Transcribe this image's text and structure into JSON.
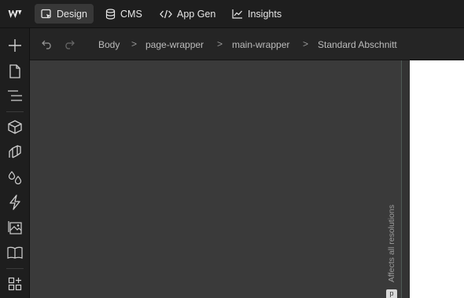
{
  "topbar": {
    "logo": "webflow-logo",
    "tabs": [
      {
        "label": "Design",
        "icon": "design-icon",
        "active": true
      },
      {
        "label": "CMS",
        "icon": "database-icon",
        "active": false
      },
      {
        "label": "App Gen",
        "icon": "code-icon",
        "active": false
      },
      {
        "label": "Insights",
        "icon": "chart-icon",
        "active": false
      }
    ]
  },
  "rail": {
    "items": [
      {
        "name": "add-icon",
        "tooltip": "Add"
      },
      {
        "name": "pages-icon",
        "tooltip": "Pages"
      },
      {
        "name": "navigator-icon",
        "tooltip": "Navigator"
      },
      {
        "name": "components-icon",
        "tooltip": "Components"
      },
      {
        "name": "styles-icon",
        "tooltip": "Styles"
      },
      {
        "name": "variables-icon",
        "tooltip": "Variables"
      },
      {
        "name": "interactions-icon",
        "tooltip": "Interactions"
      },
      {
        "name": "assets-icon",
        "tooltip": "Assets"
      },
      {
        "name": "library-icon",
        "tooltip": "Library"
      },
      {
        "name": "apps-icon",
        "tooltip": "Apps"
      }
    ]
  },
  "breadcrumb": {
    "items": [
      "Body",
      "page-wrapper",
      "main-wrapper",
      "Standard Abschnitt"
    ],
    "separator": ">"
  },
  "canvas": {
    "vertical_note": "Affects all resolutions",
    "chip_label": "p"
  },
  "colors": {
    "chrome": "#1e1e1e",
    "crumbbar": "#252525",
    "canvas": "#3a3a3a",
    "preview": "#ffffff",
    "active_tab": "#383838"
  }
}
